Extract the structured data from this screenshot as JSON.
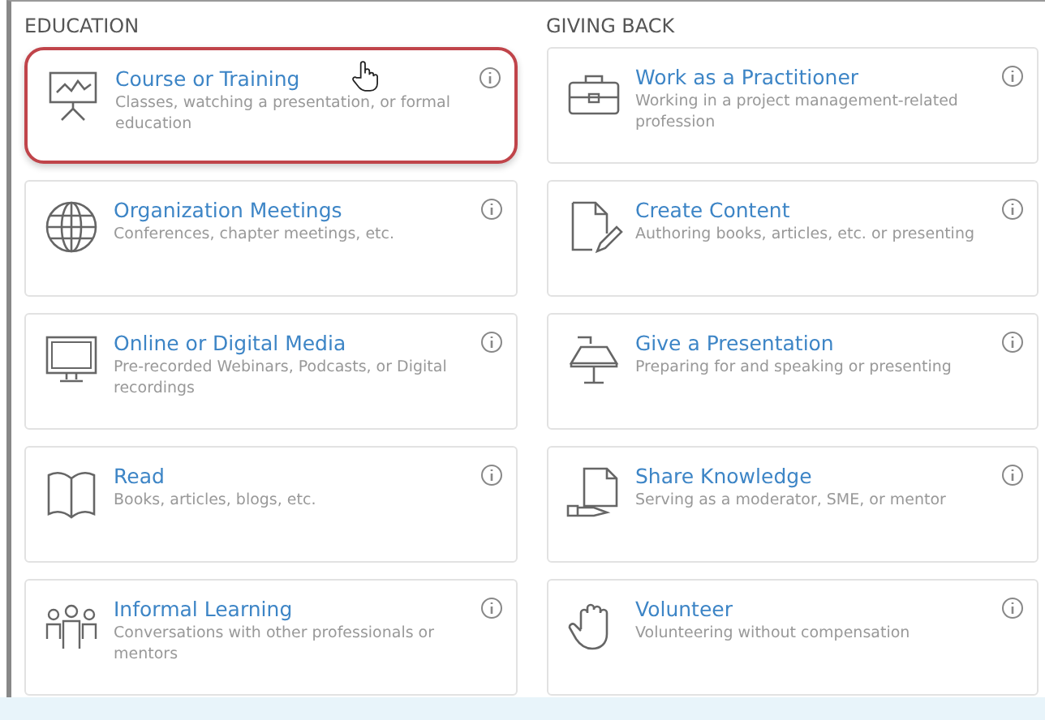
{
  "columns": [
    {
      "heading": "EDUCATION",
      "cards": [
        {
          "title": "Course or Training",
          "description": "Classes, watching a presentation, or formal education",
          "selected": true
        },
        {
          "title": "Organization Meetings",
          "description": "Conferences, chapter meetings, etc.",
          "selected": false
        },
        {
          "title": "Online or Digital Media",
          "description": "Pre-recorded Webinars, Podcasts, or Digital recordings",
          "selected": false
        },
        {
          "title": "Read",
          "description": "Books, articles, blogs, etc.",
          "selected": false
        },
        {
          "title": "Informal Learning",
          "description": "Conversations with other professionals or mentors",
          "selected": false
        }
      ]
    },
    {
      "heading": "GIVING BACK",
      "cards": [
        {
          "title": "Work as a Practitioner",
          "description": "Working in a project management-related profession",
          "selected": false
        },
        {
          "title": "Create Content",
          "description": "Authoring books, articles, etc. or presenting",
          "selected": false
        },
        {
          "title": "Give a Presentation",
          "description": "Preparing for and speaking or presenting",
          "selected": false
        },
        {
          "title": "Share Knowledge",
          "description": "Serving as a moderator, SME, or mentor",
          "selected": false
        },
        {
          "title": "Volunteer",
          "description": "Volunteering without compensation",
          "selected": false
        }
      ]
    }
  ]
}
